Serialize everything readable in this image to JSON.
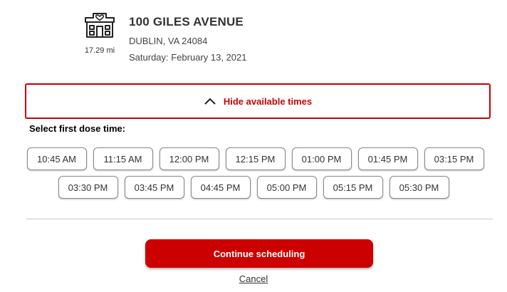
{
  "location": {
    "icon": "store-building-icon",
    "distance": "17.29 mi",
    "name": "100 GILES AVENUE",
    "city": "DUBLIN, VA 24084",
    "date": "Saturday: February 13, 2021"
  },
  "toggle": {
    "icon": "chevron-up-icon",
    "label": "Hide available times"
  },
  "times": {
    "heading": "Select first dose time:",
    "row1": [
      "10:45 AM",
      "11:15 AM",
      "12:00 PM",
      "12:15 PM",
      "01:00 PM",
      "01:45 PM",
      "03:15 PM"
    ],
    "row2": [
      "03:30 PM",
      "03:45 PM",
      "04:45 PM",
      "05:00 PM",
      "05:15 PM",
      "05:30 PM"
    ]
  },
  "actions": {
    "continue_label": "Continue scheduling",
    "cancel_label": "Cancel"
  },
  "colors": {
    "accent": "#cc0000",
    "text": "#333333",
    "border": "#8a8a8a"
  }
}
